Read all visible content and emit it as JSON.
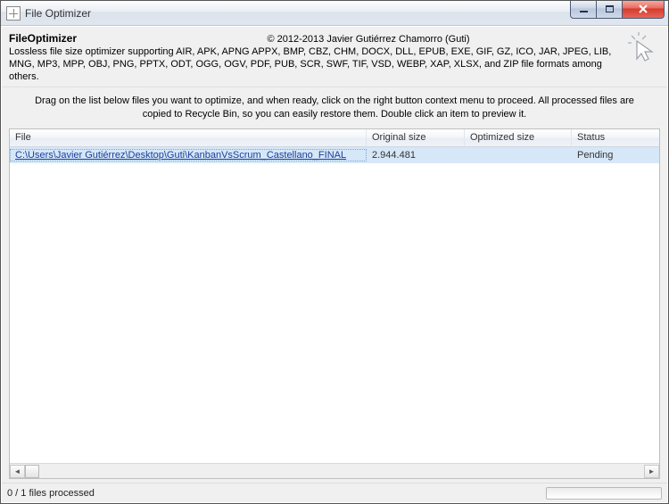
{
  "window": {
    "title": "File Optimizer"
  },
  "header": {
    "app_name": "FileOptimizer",
    "copyright": "© 2012-2013 Javier Gutiérrez Chamorro (Guti)",
    "description": "Lossless file size optimizer supporting AIR, APK, APNG APPX, BMP, CBZ, CHM, DOCX, DLL, EPUB, EXE, GIF, GZ, ICO, JAR, JPEG, LIB, MNG, MP3, MPP, OBJ, PNG, PPTX, ODT, OGG, OGV, PDF, PUB, SCR, SWF, TIF, VSD, WEBP, XAP, XLSX, and ZIP file formats among others."
  },
  "instructions": "Drag on the list below files you want to optimize, and when ready, click on the right button context menu to proceed. All processed files are copied to Recycle Bin, so you can easily restore them. Double click an item to preview it.",
  "grid": {
    "columns": {
      "file": "File",
      "original": "Original size",
      "optimized": "Optimized size",
      "status": "Status"
    },
    "rows": [
      {
        "file": "C:\\Users\\Javier Gutiérrez\\Desktop\\Guti\\KanbanVsScrum_Castellano_FINAL",
        "original": "2.944.481",
        "optimized": "",
        "status": "Pending"
      }
    ]
  },
  "statusbar": {
    "text": "0 / 1 files processed"
  }
}
